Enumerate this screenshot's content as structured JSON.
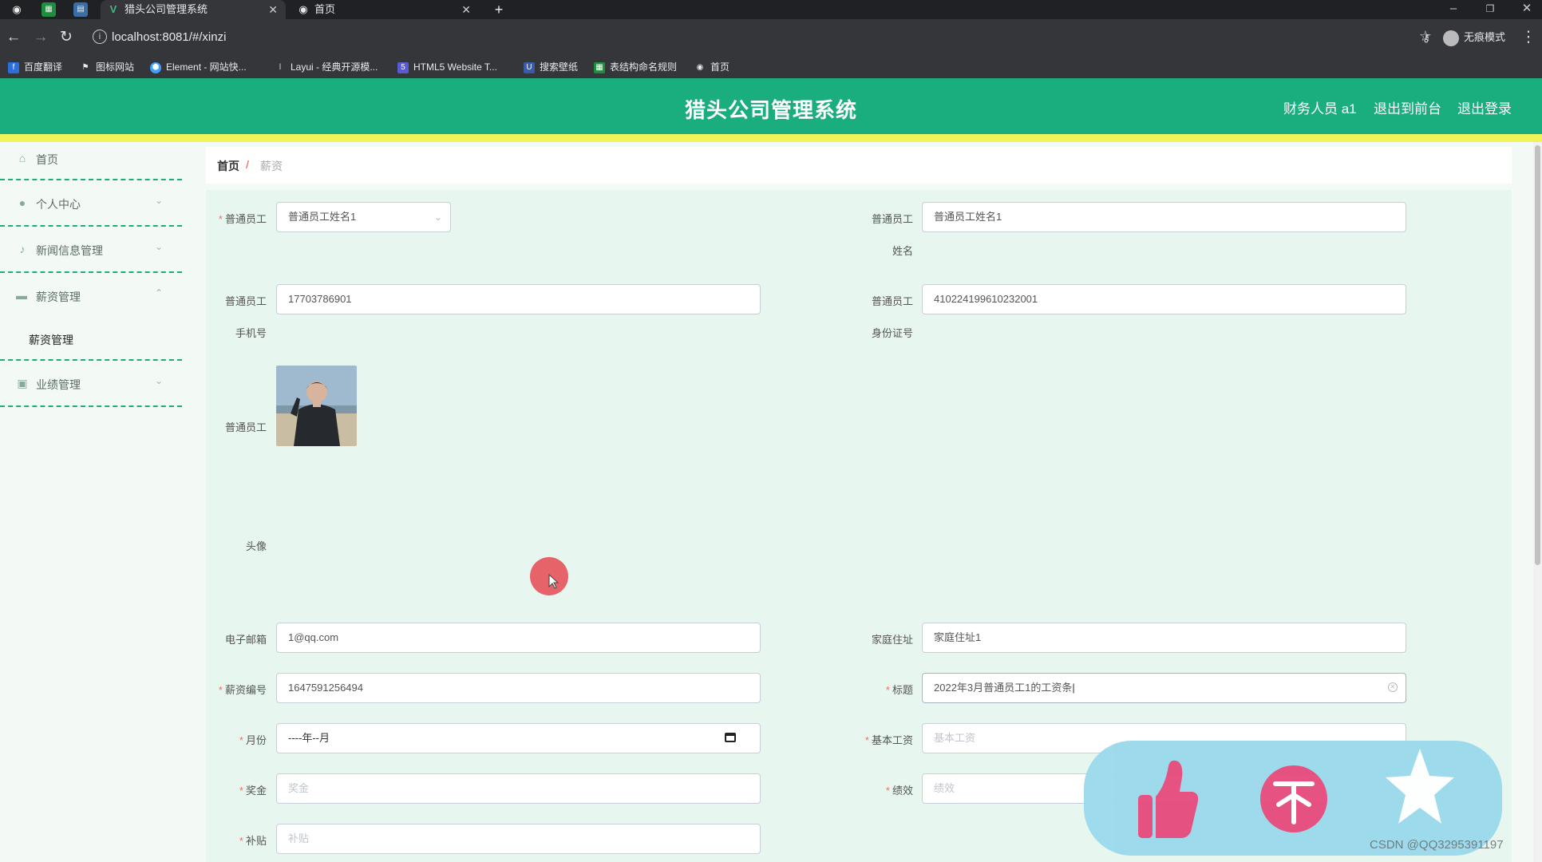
{
  "browser": {
    "tabs": [
      {
        "title": "猎头公司管理系统",
        "active": true
      },
      {
        "title": "首页",
        "active": false
      }
    ],
    "new_tab": "+",
    "url": "localhost:8081/#/xinzi",
    "profile": "无痕模式",
    "bookmarks": [
      "百度翻译",
      "图标网站",
      "Element - 网站快...",
      "Layui - 经典开源模...",
      "HTML5 Website T...",
      "搜索壁纸",
      "表结构命名规则",
      "首页"
    ]
  },
  "header": {
    "title": "猎头公司管理系统",
    "user": "财务人员 a1",
    "back_front": "退出到前台",
    "logout": "退出登录",
    "accent": "#1aae7e",
    "stripe": "#f2f25a"
  },
  "sidebar": {
    "items": [
      {
        "label": "首页",
        "icon": "home-icon"
      },
      {
        "label": "个人中心",
        "icon": "user-icon"
      },
      {
        "label": "新闻信息管理",
        "icon": "microphone-icon"
      },
      {
        "label": "薪资管理",
        "icon": "briefcase-icon"
      },
      {
        "label": "业绩管理",
        "icon": "clipboard-icon"
      }
    ],
    "sub_item": "薪资管理"
  },
  "breadcrumb": {
    "home": "首页",
    "sep": "/",
    "current": "薪资"
  },
  "form": {
    "employee": {
      "label_l1": "普通员工",
      "value": "普通员工姓名1",
      "required": true
    },
    "employee_name": {
      "label_l1": "普通员工",
      "label_l2": "姓名",
      "value": "普通员工姓名1"
    },
    "phone": {
      "label_l1": "普通员工",
      "label_l2": "手机号",
      "value": "17703786901"
    },
    "id_card": {
      "label_l1": "普通员工",
      "label_l2": "身份证号",
      "value": "410224199610232001"
    },
    "avatar": {
      "label_l1": "普通员工",
      "label_l2": "头像"
    },
    "email": {
      "label": "电子邮箱",
      "value": "1@qq.com"
    },
    "address": {
      "label": "家庭住址",
      "value": "家庭住址1"
    },
    "salary_no": {
      "label": "薪资编号",
      "value": "1647591256494",
      "required": true
    },
    "title": {
      "label": "标题",
      "value": "2022年3月普通员工1的工资条",
      "required": true
    },
    "month": {
      "label": "月份",
      "value": "----年--月",
      "required": true
    },
    "base_salary": {
      "label": "基本工资",
      "placeholder": "基本工资",
      "required": true
    },
    "bonus": {
      "label": "奖金",
      "placeholder": "奖金",
      "required": true
    },
    "performance": {
      "label": "绩效",
      "placeholder": "绩效",
      "required": true
    },
    "subsidy": {
      "label": "补贴",
      "placeholder": "补贴",
      "required": true
    }
  },
  "overlay": {
    "watermark": "CSDN @QQ3295391197",
    "icons": [
      "thumbs-up-icon",
      "coin-icon",
      "star-icon"
    ]
  }
}
